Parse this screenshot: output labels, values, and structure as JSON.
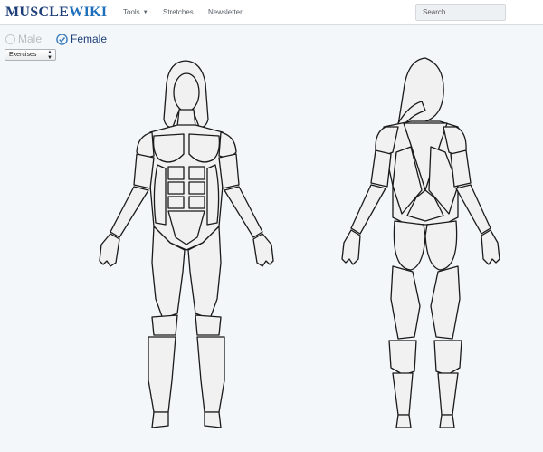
{
  "brand": {
    "part1": "MUSCLE",
    "part2": "WIKI"
  },
  "nav": {
    "tools": "Tools",
    "stretches": "Stretches",
    "newsletter": "Newsletter"
  },
  "search": {
    "placeholder": "Search"
  },
  "gender": {
    "male": "Male",
    "female": "Female",
    "selected": "Female"
  },
  "select": {
    "value": "Exercises"
  },
  "colors": {
    "brand_dark": "#1f3f78",
    "brand_light": "#1d6fbb",
    "accent": "#3b7dbf",
    "background": "#f3f7fa"
  },
  "icons": [
    "radio-empty-icon",
    "check-circle-icon",
    "caret-down-icon",
    "select-arrows-icon"
  ]
}
